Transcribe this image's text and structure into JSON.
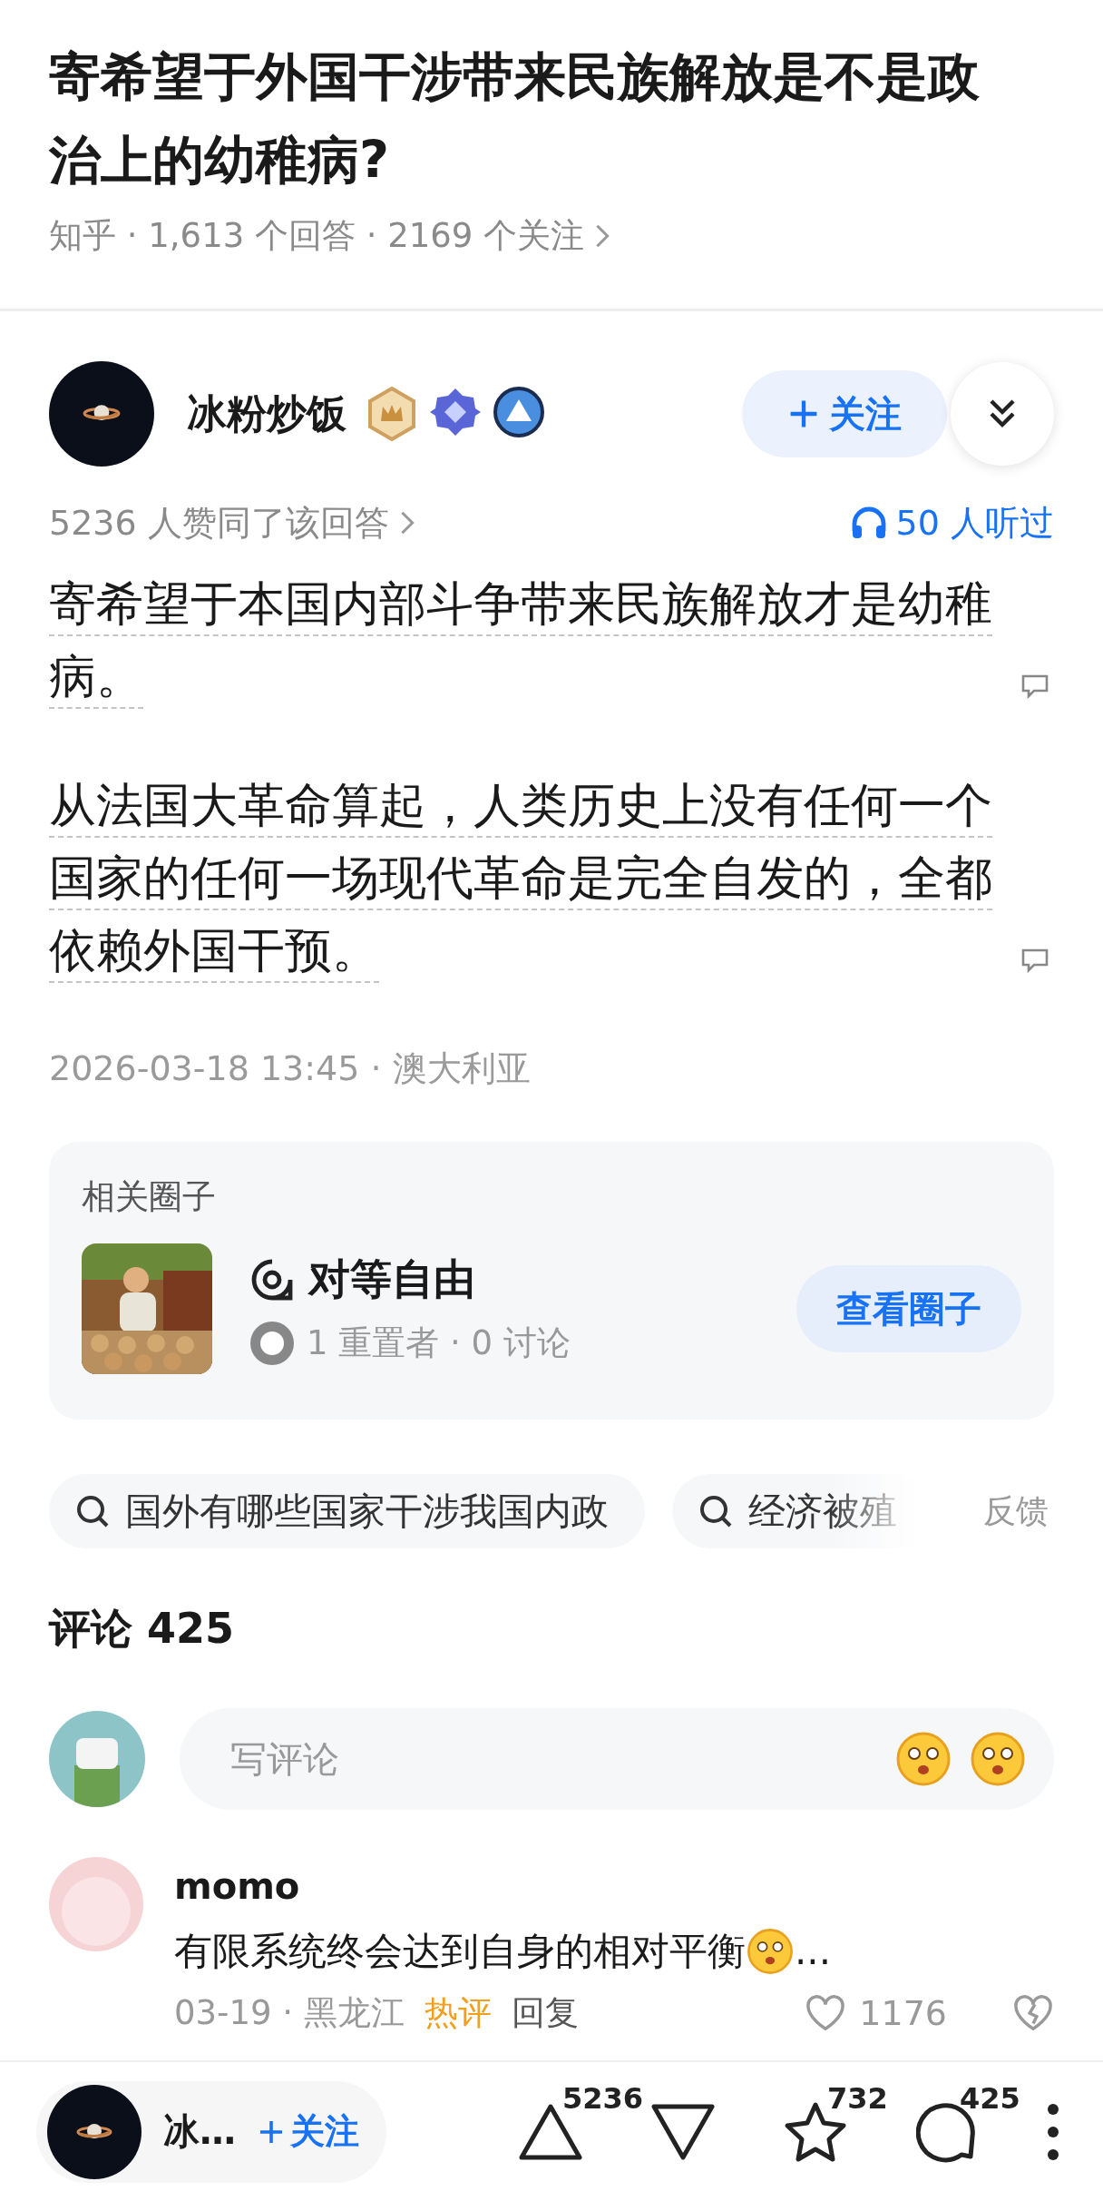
{
  "question": {
    "title": "寄希望于外国干涉带来民族解放是不是政治上的幼稚病?",
    "meta": "知乎 · 1,613 个回答 · 2169 个关注"
  },
  "author": {
    "name": "冰粉炒饭",
    "badges": [
      {
        "kind": "crown"
      },
      {
        "kind": "diamond"
      },
      {
        "kind": "triangle"
      }
    ],
    "follow": "关注",
    "followed": false
  },
  "approvals": "5236 人赞同了该回答",
  "listened": "50 人听过",
  "paragraphs": [
    "寄希望于本国内部斗争带来民族解放才是幼稚病。",
    "从法国大革命算起，人类历史上没有任何一个国家的任何一场现代革命是完全自发的，全都依赖外国干预。"
  ],
  "date": "2026-03-18 13:45 · 澳大利亚",
  "circle": {
    "heading": "相关圈子",
    "name": "对等自由",
    "stats": "1 重置者 · 0 讨论",
    "button": "查看圈子"
  },
  "searches": [
    {
      "text": "国外有哪些国家干涉我国内政",
      "faded": false
    },
    {
      "text": "经济被殖",
      "faded": true
    }
  ],
  "feedback": "反馈",
  "comments_heading": "评论 425",
  "comment_input": {
    "placeholder": "写评论"
  },
  "comments": [
    {
      "user": "momo",
      "text": "有限系统终会达到自身的相对平衡",
      "ellipsis": "...",
      "date": "03-19 · 黑龙江",
      "tag": "热评",
      "reply": "回复",
      "likes": "1176",
      "liked": false
    }
  ],
  "bottom_bar": {
    "author": "冰…",
    "follow": "关注",
    "actions": [
      {
        "kind": "up",
        "count": "5236"
      },
      {
        "kind": "down"
      },
      {
        "kind": "star",
        "count": "732"
      },
      {
        "kind": "comment",
        "count": "425"
      },
      {
        "kind": "more"
      }
    ]
  }
}
